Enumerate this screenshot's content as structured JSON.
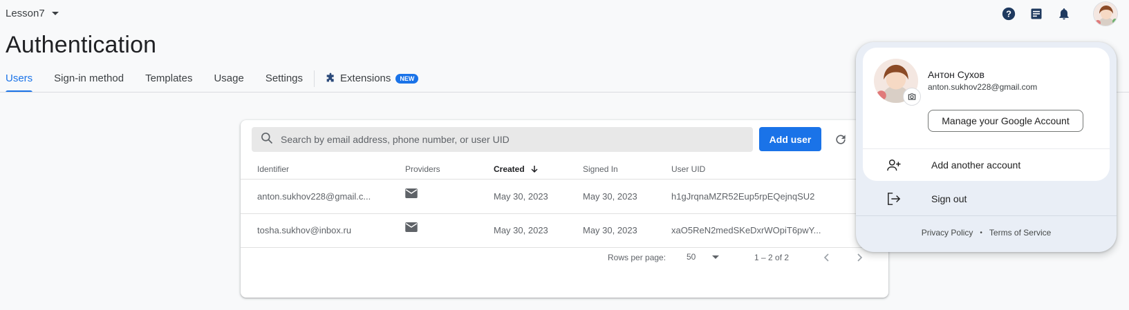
{
  "project": {
    "name": "Lesson7"
  },
  "page": {
    "title": "Authentication"
  },
  "tabs": [
    {
      "label": "Users",
      "active": true
    },
    {
      "label": "Sign-in method"
    },
    {
      "label": "Templates"
    },
    {
      "label": "Usage"
    },
    {
      "label": "Settings"
    },
    {
      "label": "Extensions",
      "badge": "NEW"
    }
  ],
  "search": {
    "placeholder": "Search by email address, phone number, or user UID"
  },
  "toolbar": {
    "add_user_label": "Add user"
  },
  "table": {
    "columns": [
      "Identifier",
      "Providers",
      "Created",
      "Signed In",
      "User UID"
    ],
    "rows": [
      {
        "identifier": "anton.sukhov228@gmail.c...",
        "provider": "mail-icon",
        "created": "May 30, 2023",
        "signed_in": "May 30, 2023",
        "uid": "h1gJrqnaMZR52Eup5rpEQejnqSU2"
      },
      {
        "identifier": "tosha.sukhov@inbox.ru",
        "provider": "mail-icon",
        "created": "May 30, 2023",
        "signed_in": "May 30, 2023",
        "uid": "xaO5ReN2medSKeDxrWOpiT6pwY..."
      }
    ]
  },
  "pagination": {
    "rows_per_page_label": "Rows per page:",
    "rows_per_page": "50",
    "range": "1 – 2 of 2"
  },
  "account": {
    "name": "Антон Сухов",
    "email": "anton.sukhov228@gmail.com",
    "manage_label": "Manage your Google Account",
    "add_account_label": "Add another account",
    "sign_out_label": "Sign out",
    "privacy_label": "Privacy Policy",
    "separator": "•",
    "terms_label": "Terms of Service"
  },
  "colors": {
    "accent": "#1a73e8",
    "popup_bg": "#e9eef6"
  }
}
